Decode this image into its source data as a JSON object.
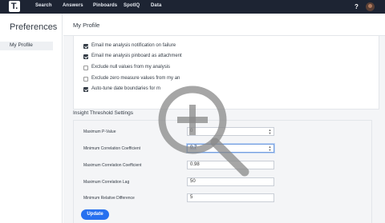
{
  "nav": {
    "logo": "T.",
    "items": [
      "Search",
      "Answers",
      "Pinboards",
      "SpotIQ",
      "Data"
    ],
    "help": "?"
  },
  "sidebar": {
    "title": "Preferences",
    "items": [
      {
        "label": "My Profile"
      }
    ]
  },
  "main": {
    "title": "My Profile"
  },
  "analysis_options": [
    {
      "label": "Email me analysis notification on failure",
      "checked": true
    },
    {
      "label": "Email me analysis pinboard as attachment",
      "checked": true
    },
    {
      "label": "Exclude null values from my analysis",
      "checked": false
    },
    {
      "label": "Exclude zero measure values from my an",
      "checked": false
    },
    {
      "label": "Auto-tune date boundaries for m",
      "checked": true
    }
  ],
  "insight": {
    "title": "Insight Threshold Settings",
    "fields": [
      {
        "label": "Maximum P-Value",
        "value": "0"
      },
      {
        "label": "Minimum Correlation Coefficient",
        "value": "0.7"
      },
      {
        "label": "Maximum Correlation Coefficient",
        "value": "0.98"
      },
      {
        "label": "Maximum Correlation Lag",
        "value": "50"
      },
      {
        "label": "Minimum Relative Difference",
        "value": "5"
      }
    ],
    "update_label": "Update"
  },
  "icons": {
    "zoom_overlay": "zoom-in-icon",
    "help": "help-icon",
    "avatar": "avatar"
  },
  "colors": {
    "nav_bg": "#1d2433",
    "accent": "#2770ef"
  }
}
